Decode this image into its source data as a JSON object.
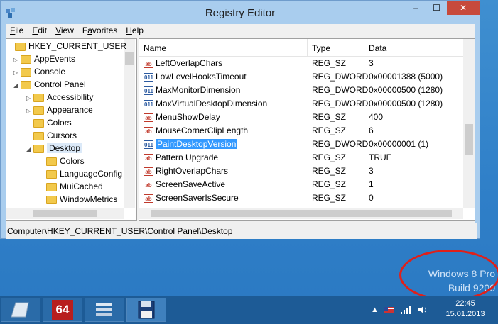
{
  "window": {
    "title": "Registry Editor",
    "minimize_glyph": "–",
    "maximize_glyph": "☐",
    "close_glyph": "✕"
  },
  "menu": [
    {
      "label": "File",
      "mnemonic": "F"
    },
    {
      "label": "Edit",
      "mnemonic": "E"
    },
    {
      "label": "View",
      "mnemonic": "V"
    },
    {
      "label": "Favorites",
      "mnemonic": "a"
    },
    {
      "label": "Help",
      "mnemonic": "H"
    }
  ],
  "tree": {
    "items": [
      {
        "label": "HKEY_CURRENT_USER",
        "arrow": ""
      },
      {
        "label": "AppEvents",
        "arrow": "▷"
      },
      {
        "label": "Console",
        "arrow": "▷"
      },
      {
        "label": "Control Panel",
        "arrow": "◢"
      },
      {
        "label": "Accessibility",
        "arrow": "▷"
      },
      {
        "label": "Appearance",
        "arrow": "▷"
      },
      {
        "label": "Colors",
        "arrow": ""
      },
      {
        "label": "Cursors",
        "arrow": ""
      },
      {
        "label": "Desktop",
        "arrow": "◢"
      },
      {
        "label": "Colors",
        "arrow": ""
      },
      {
        "label": "LanguageConfig",
        "arrow": ""
      },
      {
        "label": "MuiCached",
        "arrow": ""
      },
      {
        "label": "WindowMetrics",
        "arrow": ""
      }
    ]
  },
  "list": {
    "columns": [
      "Name",
      "Type",
      "Data"
    ],
    "rows": [
      {
        "icon": "ab",
        "name": "LeftOverlapChars",
        "type": "REG_SZ",
        "data": "3"
      },
      {
        "icon": "dw",
        "name": "LowLevelHooksTimeout",
        "type": "REG_DWORD",
        "data": "0x00001388 (5000)"
      },
      {
        "icon": "dw",
        "name": "MaxMonitorDimension",
        "type": "REG_DWORD",
        "data": "0x00000500 (1280)"
      },
      {
        "icon": "dw",
        "name": "MaxVirtualDesktopDimension",
        "type": "REG_DWORD",
        "data": "0x00000500 (1280)"
      },
      {
        "icon": "ab",
        "name": "MenuShowDelay",
        "type": "REG_SZ",
        "data": "400"
      },
      {
        "icon": "ab",
        "name": "MouseCornerClipLength",
        "type": "REG_SZ",
        "data": "6"
      },
      {
        "icon": "dw",
        "name": "PaintDesktopVersion",
        "type": "REG_DWORD",
        "data": "0x00000001 (1)"
      },
      {
        "icon": "ab",
        "name": "Pattern Upgrade",
        "type": "REG_SZ",
        "data": "TRUE"
      },
      {
        "icon": "ab",
        "name": "RightOverlapChars",
        "type": "REG_SZ",
        "data": "3"
      },
      {
        "icon": "ab",
        "name": "ScreenSaveActive",
        "type": "REG_SZ",
        "data": "1"
      },
      {
        "icon": "ab",
        "name": "ScreenSaverIsSecure",
        "type": "REG_SZ",
        "data": "0"
      }
    ]
  },
  "status_path": "Computer\\HKEY_CURRENT_USER\\Control Panel\\Desktop",
  "desktop_watermark": {
    "line1": "Windows 8 Pro",
    "line2": "Build 9200"
  },
  "taskbar": {
    "app_badge": "64",
    "clock_time": "22:45",
    "clock_date": "15.01.2013"
  },
  "colors": {
    "selection": "#3399ff",
    "annotation_circle": "#e0201a",
    "taskbar": "#1d5b96"
  }
}
